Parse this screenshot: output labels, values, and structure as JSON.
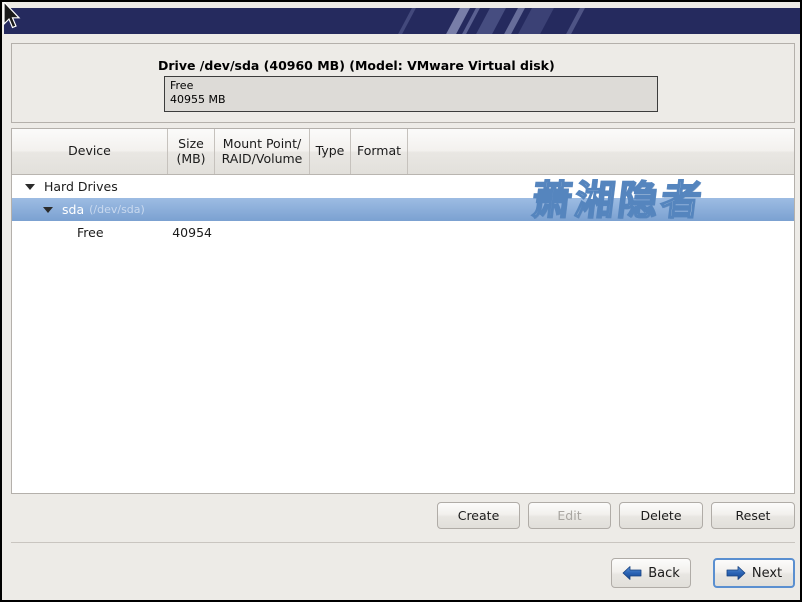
{
  "window": {
    "title": "",
    "cursor_icon": "mouse-pointer-icon"
  },
  "banner": {
    "background_color": "#252a5e",
    "streak_color": "#bec3e6"
  },
  "drive_summary": {
    "title": "Drive /dev/sda (40960 MB) (Model: VMware Virtual disk)",
    "segments": [
      {
        "label": "Free",
        "size_label": "40955 MB"
      }
    ]
  },
  "tree": {
    "columns": [
      {
        "key": "device",
        "label": "Device"
      },
      {
        "key": "size",
        "label_line1": "Size",
        "label_line2": "(MB)"
      },
      {
        "key": "mount",
        "label_line1": "Mount Point/",
        "label_line2": "RAID/Volume"
      },
      {
        "key": "type",
        "label": "Type"
      },
      {
        "key": "format",
        "label": "Format"
      }
    ],
    "rows": [
      {
        "name": "Hard Drives",
        "indent": 0,
        "expander": "chevron-down-icon",
        "size": "",
        "mount": "",
        "type": "",
        "format": "",
        "selected": false
      },
      {
        "name": "sda",
        "subpath": "(/dev/sda)",
        "indent": 1,
        "expander": "chevron-down-icon",
        "size": "",
        "mount": "",
        "type": "",
        "format": "",
        "selected": true
      },
      {
        "name": "Free",
        "indent": 2,
        "expander": "none",
        "size": "40954",
        "mount": "",
        "type": "",
        "format": "",
        "selected": false
      }
    ],
    "selection_color": "#8cb0db"
  },
  "watermark": {
    "text": "萧湘隐者",
    "color": "#ffffff",
    "outline_color": "#5585be"
  },
  "actions": {
    "create_label": "Create",
    "edit_label": "Edit",
    "edit_disabled": true,
    "delete_label": "Delete",
    "reset_label": "Reset"
  },
  "navigation": {
    "back_label": "Back",
    "back_icon": "arrow-left-icon",
    "next_label": "Next",
    "next_icon": "arrow-right-icon",
    "next_focused": true,
    "arrow_color": "#2a63b5",
    "focus_border_color": "#5a8fd0"
  }
}
